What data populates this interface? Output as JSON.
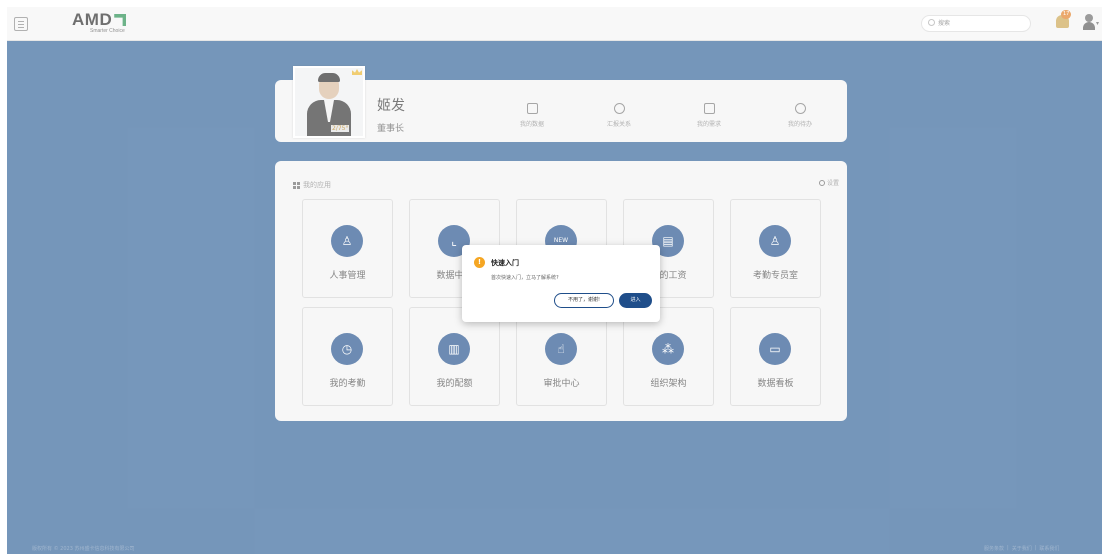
{
  "header": {
    "logo_text": "AMD",
    "logo_tagline": "Smarter Choice",
    "search_placeholder": "搜索",
    "notification_count": "17"
  },
  "profile": {
    "name": "姬发",
    "title": "董事长",
    "photo_tag": "2/75°",
    "quick_links": [
      {
        "label": "我的数据",
        "icon": "document-icon"
      },
      {
        "label": "汇报关系",
        "icon": "relation-icon"
      },
      {
        "label": "我的需求",
        "icon": "file-icon"
      },
      {
        "label": "我的待办",
        "icon": "clock-icon"
      }
    ]
  },
  "apps": {
    "title": "我的应用",
    "settings_label": "设置",
    "items": [
      {
        "label": "人事管理",
        "icon": "person-icon"
      },
      {
        "label": "数据中心",
        "icon": "chart-icon"
      },
      {
        "label": "",
        "icon": "new-icon"
      },
      {
        "label": "我的工资",
        "icon": "salary-icon"
      },
      {
        "label": "考勤专员室",
        "icon": "user-icon"
      },
      {
        "label": "我的考勤",
        "icon": "clock-icon"
      },
      {
        "label": "我的配额",
        "icon": "quota-icon"
      },
      {
        "label": "审批中心",
        "icon": "hand-icon"
      },
      {
        "label": "组织架构",
        "icon": "org-icon"
      },
      {
        "label": "数据看板",
        "icon": "monitor-icon"
      }
    ]
  },
  "dialog": {
    "title": "快速入门",
    "message": "首次快速入门，立马了解系统?",
    "cancel_label": "不用了，谢谢!",
    "ok_label": "进入"
  },
  "footer": {
    "copyright": "版权所有 © 2023 苏州盛卡信息科技有限公司",
    "links": [
      "服务条款",
      "|",
      "关于我们",
      "|",
      "联系我们"
    ]
  }
}
